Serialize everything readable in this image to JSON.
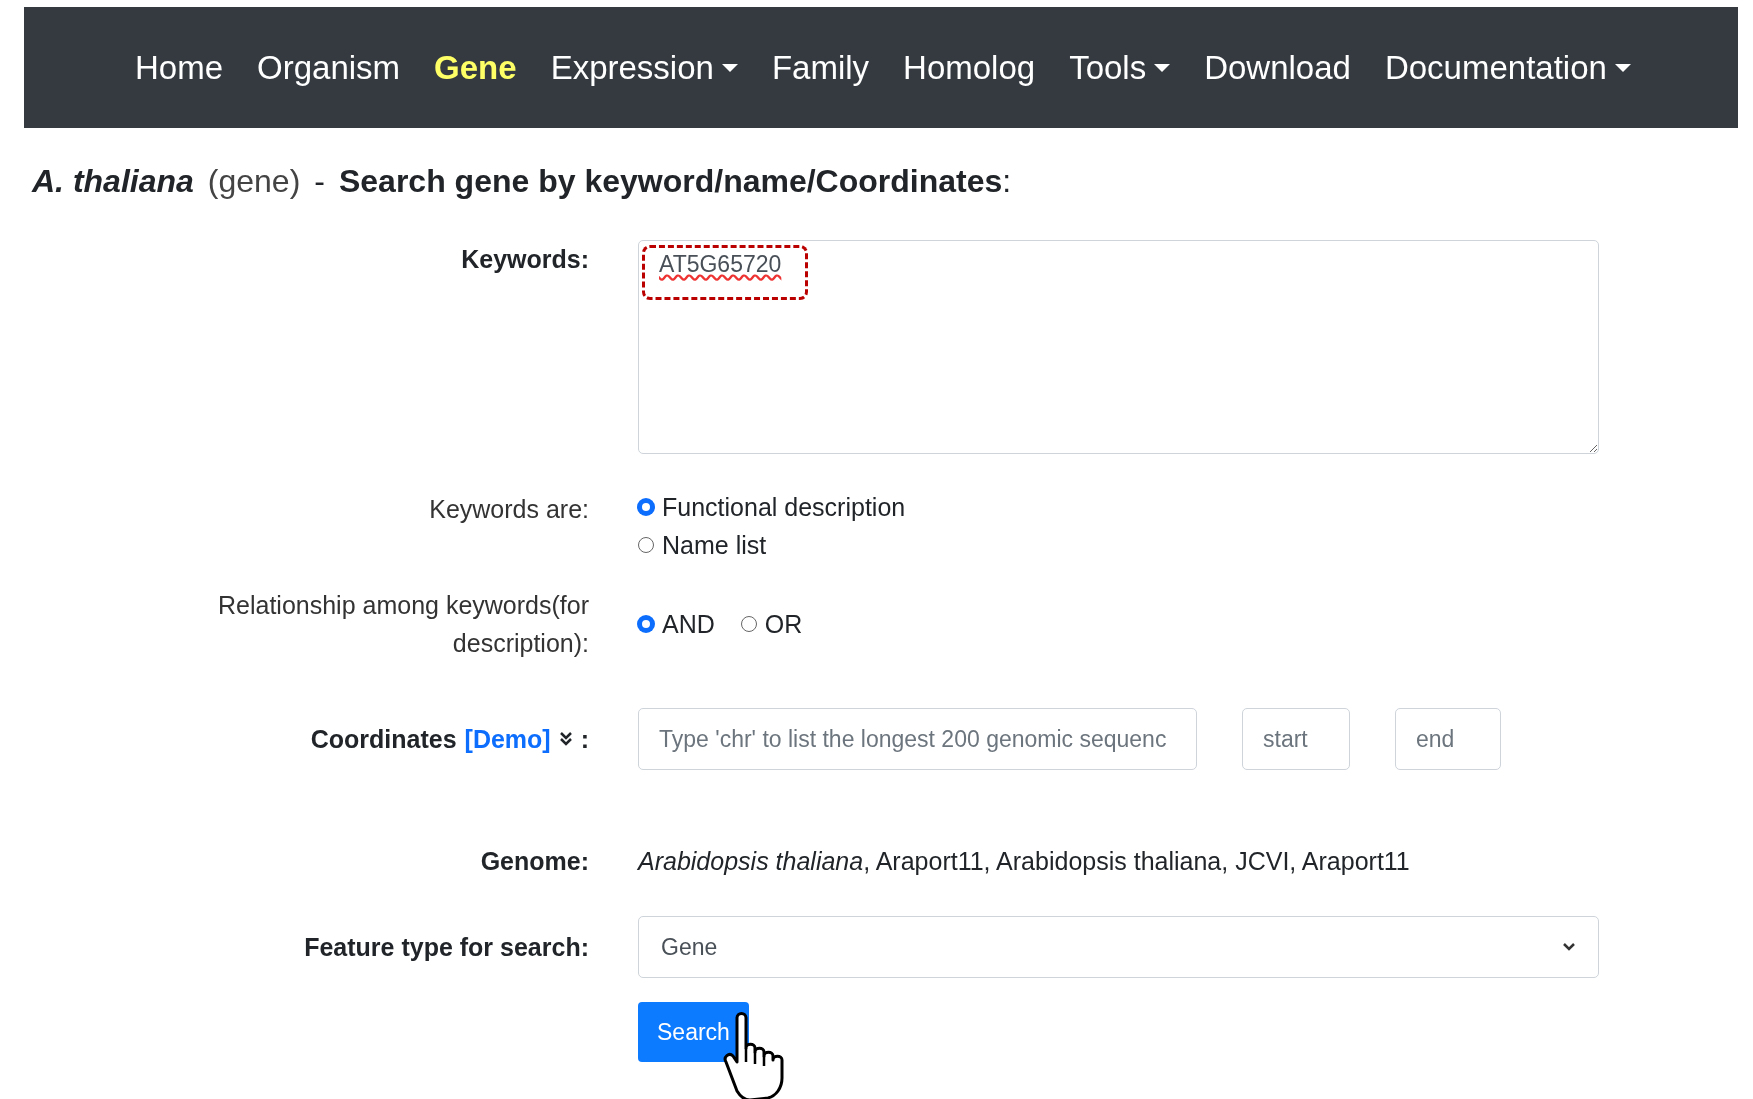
{
  "nav": [
    {
      "label": "Home",
      "selected": false,
      "dropdown": false
    },
    {
      "label": "Organism",
      "selected": false,
      "dropdown": false
    },
    {
      "label": "Gene",
      "selected": true,
      "dropdown": false
    },
    {
      "label": "Expression",
      "selected": false,
      "dropdown": true
    },
    {
      "label": "Family",
      "selected": false,
      "dropdown": false
    },
    {
      "label": "Homolog",
      "selected": false,
      "dropdown": false
    },
    {
      "label": "Tools",
      "selected": false,
      "dropdown": true
    },
    {
      "label": "Download",
      "selected": false,
      "dropdown": false
    },
    {
      "label": "Documentation",
      "selected": false,
      "dropdown": true
    }
  ],
  "title": {
    "organism": "A. thaliana",
    "type": "(gene)",
    "separator": "-",
    "heading": "**Search gene by keyword/name/Coordinates**:"
  },
  "keywords": {
    "label": "Keywords:",
    "value": "AT5G65720"
  },
  "keywords_are": {
    "label": "Keywords are:",
    "options": [
      {
        "label": "Functional description",
        "selected": true
      },
      {
        "label": "Name list",
        "selected": false
      }
    ]
  },
  "relationship": {
    "label": "Relationship among keywords(for description):",
    "options": [
      {
        "label": "AND",
        "selected": true
      },
      {
        "label": "OR",
        "selected": false
      }
    ]
  },
  "coordinates": {
    "label": "Coordinates",
    "link": "[Demo]",
    "colon": ":",
    "fields": [
      {
        "placeholder": "Type 'chr' to list the longest 200 genomic sequenc"
      },
      {
        "placeholder": "start"
      },
      {
        "placeholder": "end"
      }
    ]
  },
  "genome": {
    "label": "Genome:",
    "value": "*Arabidopsis thaliana*, Araport11, Arabidopsis thaliana, JCVI, Araport11"
  },
  "feature_type": {
    "label": "Feature type for search:",
    "value": "Gene"
  },
  "search_button": "Search"
}
